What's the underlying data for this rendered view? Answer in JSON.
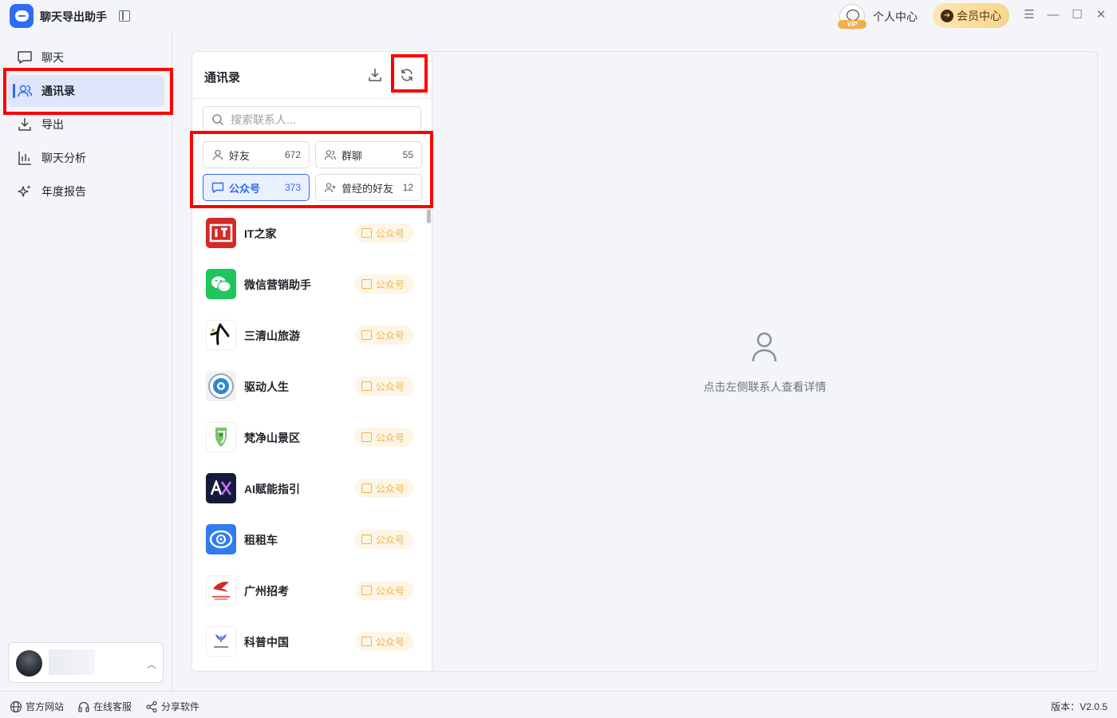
{
  "app": {
    "title": "聊天导出助手"
  },
  "header": {
    "personal_center": "个人中心",
    "member_center": "会员中心",
    "vip_badge": "VIP"
  },
  "sidebar": {
    "items": [
      {
        "label": "聊天",
        "icon": "chat-icon"
      },
      {
        "label": "通讯录",
        "icon": "contacts-icon",
        "active": true
      },
      {
        "label": "导出",
        "icon": "export-icon"
      },
      {
        "label": "聊天分析",
        "icon": "bar-chart-icon"
      },
      {
        "label": "年度报告",
        "icon": "sparkle-icon"
      }
    ]
  },
  "contacts": {
    "title": "通讯录",
    "search_placeholder": "搜索联系人...",
    "filters": [
      {
        "label": "好友",
        "count": "672"
      },
      {
        "label": "群聊",
        "count": "55"
      },
      {
        "label": "公众号",
        "count": "373",
        "active": true
      },
      {
        "label": "曾经的好友",
        "count": "12"
      }
    ],
    "list": [
      {
        "name": "IT之家",
        "tag": "公众号"
      },
      {
        "name": "微信营销助手",
        "tag": "公众号"
      },
      {
        "name": "三清山旅游",
        "tag": "公众号"
      },
      {
        "name": "驱动人生",
        "tag": "公众号"
      },
      {
        "name": "梵净山景区",
        "tag": "公众号"
      },
      {
        "name": "AI赋能指引",
        "tag": "公众号"
      },
      {
        "name": "租租车",
        "tag": "公众号"
      },
      {
        "name": "广州招考",
        "tag": "公众号"
      },
      {
        "name": "科普中国",
        "tag": "公众号"
      }
    ]
  },
  "detail": {
    "empty_text": "点击左侧联系人查看详情"
  },
  "footer": {
    "official_site": "官方网站",
    "online_service": "在线客服",
    "share": "分享软件",
    "version": "版本：V2.0.5"
  },
  "colors": {
    "accent": "#2f6bf6",
    "highlight": "#ff0000",
    "tag": "#f2b443"
  }
}
